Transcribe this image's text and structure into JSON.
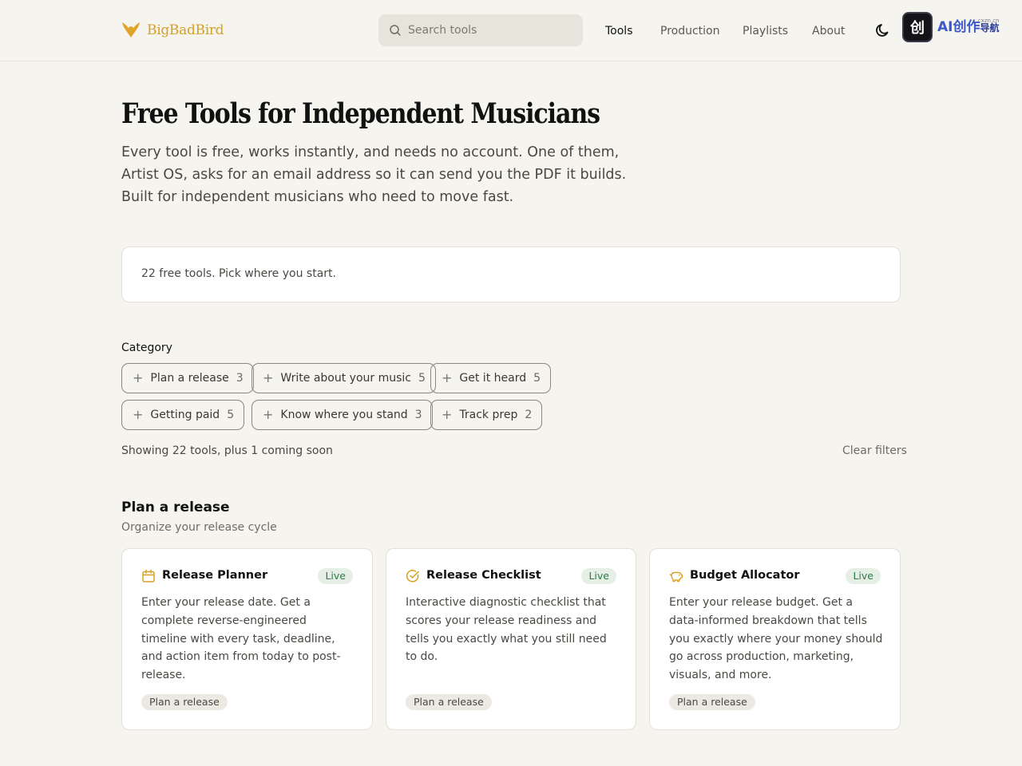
{
  "brand": {
    "name": "BigBadBird",
    "accent": "#d8a022"
  },
  "search": {
    "placeholder": "Search tools"
  },
  "nav": [
    {
      "label": "Tools",
      "active": true
    },
    {
      "label": "Production",
      "active": false
    },
    {
      "label": "Playlists",
      "active": false
    },
    {
      "label": "About",
      "active": false
    }
  ],
  "ai_badge": {
    "icon_text": "创",
    "text": "AI创作",
    "sub": "cxzn.cn",
    "nav": "导航"
  },
  "hero": {
    "title": "Free Tools for Independent Musicians",
    "subtitle": "Every tool is free, works instantly, and needs no account. One of them, Artist OS, asks for an email address so it can send you the PDF it builds. Built for independent musicians who need to move fast."
  },
  "count_text": "22 free tools. Pick where you start.",
  "filters": {
    "label": "Category",
    "chips": [
      {
        "label": "Plan a release",
        "count": "3"
      },
      {
        "label": "Write about your music",
        "count": "5"
      },
      {
        "label": "Get it heard",
        "count": "5"
      },
      {
        "label": "Getting paid",
        "count": "5"
      },
      {
        "label": "Know where you stand",
        "count": "3"
      },
      {
        "label": "Track prep",
        "count": "2"
      }
    ],
    "showing": "Showing 22 tools, plus 1 coming soon",
    "clear": "Clear filters"
  },
  "section": {
    "title": "Plan a release",
    "subtitle": "Organize your release cycle",
    "cards": [
      {
        "icon": "calendar-icon",
        "title": "Release Planner",
        "status": "Live",
        "description": "Enter your release date. Get a complete reverse-engineered timeline with every task, deadline, and action item from today to post-release.",
        "tag": "Plan a release"
      },
      {
        "icon": "check-circle-icon",
        "title": "Release Checklist",
        "status": "Live",
        "description": "Interactive diagnostic checklist that scores your release readiness and tells you exactly what you still need to do.",
        "tag": "Plan a release"
      },
      {
        "icon": "piggy-bank-icon",
        "title": "Budget Allocator",
        "status": "Live",
        "description": "Enter your release budget. Get a data-informed breakdown that tells you exactly where your money should go across production, marketing, visuals, and more.",
        "tag": "Plan a release"
      }
    ]
  }
}
